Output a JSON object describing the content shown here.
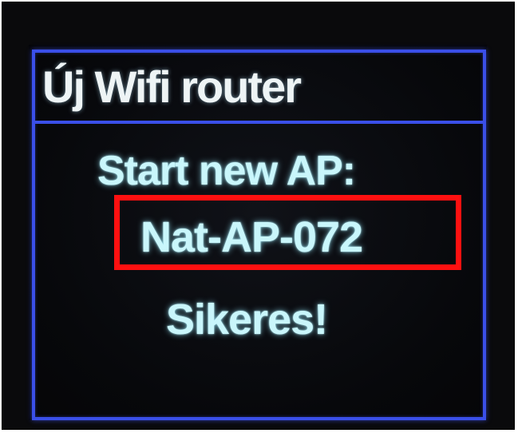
{
  "screen": {
    "title": "Új Wifi router",
    "message_line_1": "Start new AP:",
    "ap_name": "Nat-AP-072",
    "status": "Sikeres!"
  },
  "colors": {
    "border": "#3a4fe8",
    "text": "#c9f6fb",
    "highlight": "#ff1010",
    "background": "#07080b"
  }
}
